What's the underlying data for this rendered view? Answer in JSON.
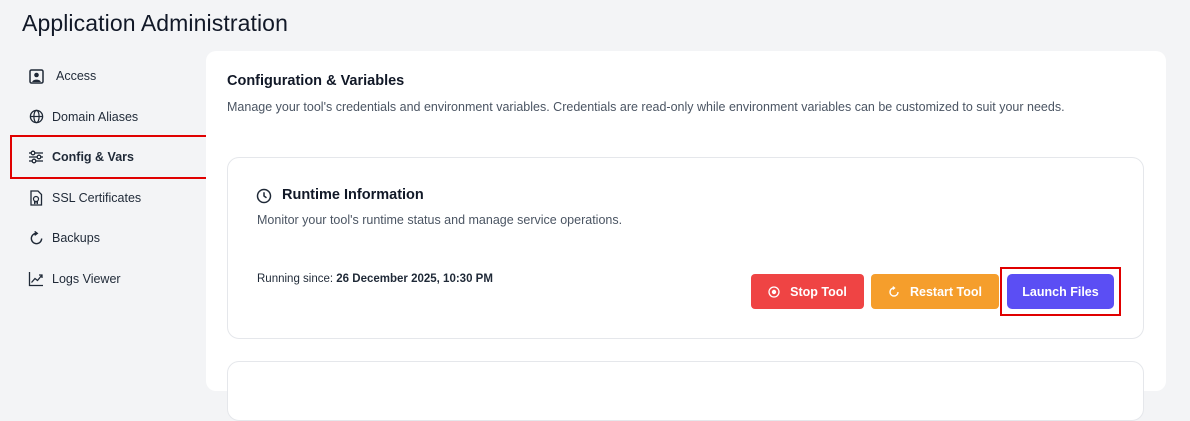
{
  "app": {
    "title": "Application Administration"
  },
  "sidebar": {
    "items": [
      {
        "label": "Access",
        "icon": "user-square-icon",
        "active": false
      },
      {
        "label": "Domain Aliases",
        "icon": "globe-icon",
        "active": false
      },
      {
        "label": "Config & Vars",
        "icon": "sliders-icon",
        "active": true
      },
      {
        "label": "SSL Certificates",
        "icon": "certificate-file-icon",
        "active": false
      },
      {
        "label": "Backups",
        "icon": "refresh-icon",
        "active": false
      },
      {
        "label": "Logs Viewer",
        "icon": "trend-chart-icon",
        "active": false
      }
    ]
  },
  "main": {
    "title": "Configuration & Variables",
    "description": "Manage your tool's credentials and environment variables. Credentials are read-only while environment variables can be customized to suit your needs.",
    "runtime": {
      "icon": "clock-icon",
      "title": "Runtime Information",
      "description": "Monitor your tool's runtime status and manage service operations.",
      "since_label": "Running since: ",
      "since_value": "26 December 2025, 10:30 PM",
      "buttons": {
        "stop": "Stop Tool",
        "restart": "Restart Tool",
        "launch": "Launch Files"
      }
    }
  },
  "colors": {
    "stop": "#ef4444",
    "restart": "#f59e2c",
    "launch": "#5b4ef4",
    "highlight": "#e00000"
  }
}
